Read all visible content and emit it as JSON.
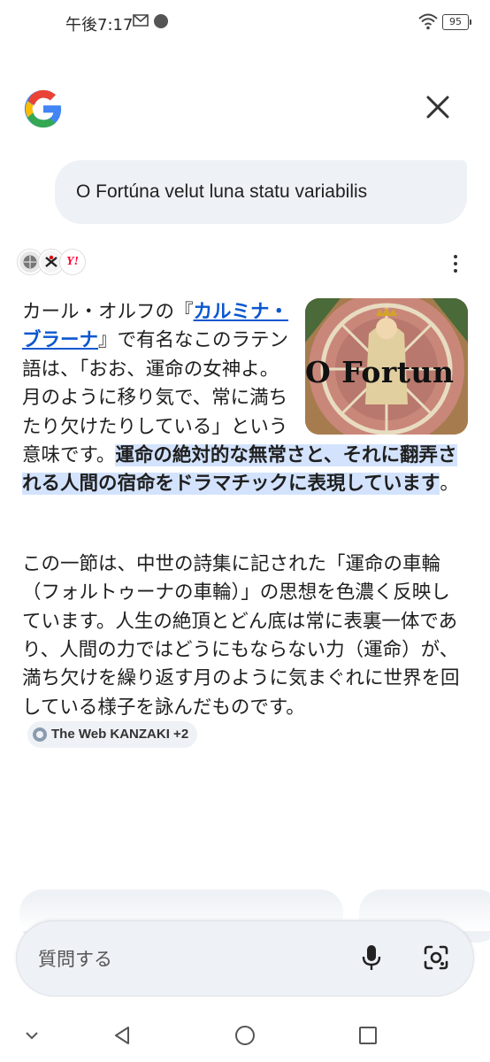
{
  "status_bar": {
    "time": "午後7:17",
    "battery": "95",
    "icons": [
      "gmail-icon",
      "notification-dot-icon",
      "wifi-icon",
      "battery-icon"
    ]
  },
  "header": {
    "logo": "google-g-logo",
    "close_icon": "close-icon"
  },
  "query": {
    "text": "O Fortúna velut luna statu variabilis"
  },
  "sources": {
    "icons": [
      "globe-icon",
      "kanzaki-icon",
      "yahoo-icon"
    ],
    "yahoo_mark": "Y!",
    "more_icon": "more-vert-icon"
  },
  "answer": {
    "thumbnail_text": "O Fortun",
    "p1_a": "カール・オルフの『",
    "p1_link": "カルミナ・ブラーナ",
    "p1_b": "』で有名なこのラテン語は、「おお、運命の女神よ。月のように移り気で、常に満ちたり欠けたりしている」という意味です。",
    "p1_highlight": "運命の絶対的な無常さと、それに翻弄される人間の宿命をドラマチックに表現しています",
    "p1_end": "。",
    "p2": "この一節は、中世の詩集に記された「運命の車輪（フォルトゥーナの車輪）」の思想を色濃く反映しています。人生の絶頂とどん底は常に表裏一体であり、人間の力ではどうにもならない力（運命）が、満ち欠けを繰り返す月のように気まぐれに世界を回している様子を詠んだものです。",
    "source_chip": "The Web KANZAKI +2"
  },
  "input": {
    "placeholder": "質問する",
    "mic_icon": "mic-icon",
    "lens_icon": "google-lens-icon"
  },
  "nav": {
    "items": [
      "chevron-down-icon",
      "back-icon",
      "home-icon",
      "recents-icon"
    ]
  },
  "colors": {
    "link": "#0b57d0",
    "highlight": "#d3e3fd",
    "bubble": "#eef1f5"
  }
}
